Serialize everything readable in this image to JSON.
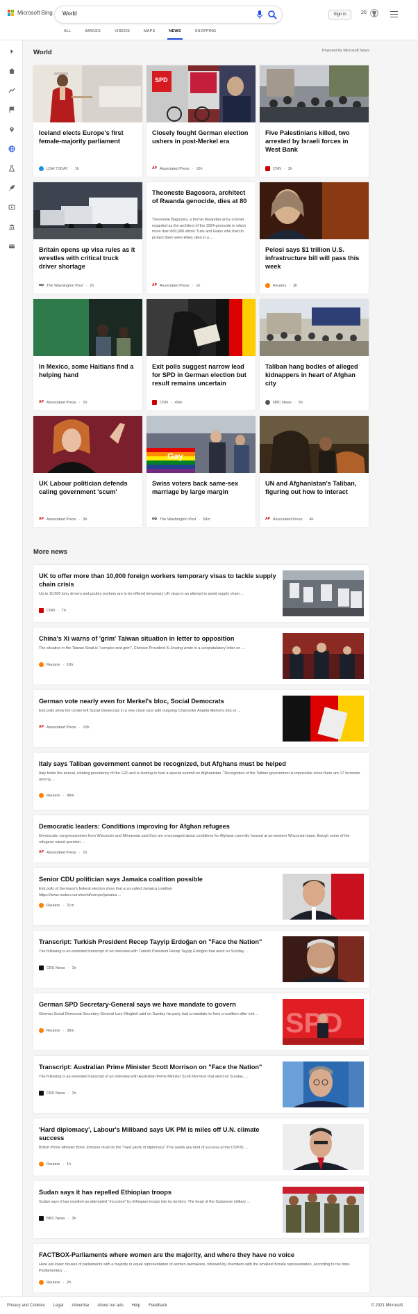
{
  "header": {
    "logo_text": "Microsoft Bing",
    "search_value": "World",
    "signin_label": "Sign in",
    "points": "20",
    "scopes": [
      "ALL",
      "IMAGES",
      "VIDEOS",
      "MAPS",
      "NEWS",
      "SHOPPING"
    ],
    "active_scope": "NEWS"
  },
  "world": {
    "title": "World",
    "powered_by": "Powered by Microsoft News",
    "cards": [
      {
        "title": "Iceland elects Europe's first female-majority parliament",
        "source": "USA TODAY",
        "time": "1h",
        "icon": "usa"
      },
      {
        "title": "Closely fought German election ushers in post-Merkel era",
        "source": "Associated Press",
        "time": "10h",
        "icon": "ap"
      },
      {
        "title": "Five Palestinians killed, two arrested by Israeli forces in West Bank",
        "source": "CNN",
        "time": "3h",
        "icon": "cnn"
      },
      {
        "title": "Britain opens up visa rules as it wrestles with critical truck driver shortage",
        "source": "The Washington Post",
        "time": "2h",
        "icon": "wapo"
      },
      {
        "title": "Theoneste Bagosora, architect of Rwanda genocide, dies at 80",
        "snippet": "Theoneste Bagosora, a former Rwandan army colonel regarded as the architect of the 1994 genocide in which more than 800,000 ethnic Tutsi and Hutus who tried to protect them were killed, died in a ...",
        "source": "Associated Press",
        "time": "1h",
        "icon": "ap"
      },
      {
        "title": "Pelosi says $1 trillion U.S. infrastructure bill will pass this week",
        "source": "Reuters",
        "time": "3h",
        "icon": "rt"
      },
      {
        "title": "In Mexico, some Haitians find a helping hand",
        "source": "Associated Press",
        "time": "1h",
        "icon": "ap"
      },
      {
        "title": "Exit polls suggest narrow lead for SPD in German election but result remains uncertain",
        "source": "CNN",
        "time": "49m",
        "icon": "cnn"
      },
      {
        "title": "Taliban hang bodies of alleged kidnappers in heart of Afghan city",
        "source": "NBC News",
        "time": "5h",
        "icon": "nbc"
      },
      {
        "title": "UK Labour politician defends caling government 'scum'",
        "source": "Associated Press",
        "time": "3h",
        "icon": "ap"
      },
      {
        "title": "Swiss voters back same-sex marriage by large margin",
        "source": "The Washington Post",
        "time": "59m",
        "icon": "wapo"
      },
      {
        "title": "UN and Afghanistan's Taliban, figuring out how to interact",
        "source": "Associated Press",
        "time": "4h",
        "icon": "ap"
      }
    ]
  },
  "more": {
    "title": "More news",
    "items": [
      {
        "title": "UK to offer more than 10,000 foreign workers temporary visas to tackle supply chain crisis",
        "snippet": "Up to 10,500 lorry drivers and poultry workers are to be offered temporary UK visas in an attempt to avoid supply chain ...",
        "source": "CNN",
        "time": "7h",
        "icon": "cnn"
      },
      {
        "title": "China's Xi warns of 'grim' Taiwan situation in letter to opposition",
        "snippet": "The situation in the Taiwan Strait is \"complex and grim\", Chinese President Xi Jinping wrote in a congratulatory letter on ...",
        "source": "Reuters",
        "time": "10h",
        "icon": "rt"
      },
      {
        "title": "German vote nearly even for Merkel's bloc, Social Democrats",
        "snippet": "Exit polls show the center-left Social Democrats in a very close race with outgoing Chancellor Angela Merkel's bloc in ...",
        "source": "Associated Press",
        "time": "10h",
        "icon": "ap"
      },
      {
        "title": "Italy says Taliban government cannot be recognized, but Afghans must be helped",
        "snippet": "Italy holds the annual, rotating presidency of the G20 and is looking to host a special summit on Afghanistan. \"Recognition of the Taliban government is impossible since there are 17 terrorists among ...",
        "source": "Reuters",
        "time": "49m",
        "icon": "rt"
      },
      {
        "title": "Democratic leaders: Conditions improving for Afghan refugees",
        "snippet": "Democratic congresswomen from Wisconsin and Minnesota said they are encouraged about conditions for Afghans currently housed at an western Wisconsin base, though some of the refugees raised question ...",
        "source": "Associated Press",
        "time": "1h",
        "icon": "ap"
      },
      {
        "title": "Senior CDU politician says Jamaica coalition possible",
        "snippet": "Exit polls of Germany's federal election show that a so-called Jamaica coalition https://www.reuters.com/world/europe/jamaica ...",
        "source": "Reuters",
        "time": "21m",
        "icon": "rt"
      },
      {
        "title": "Transcript: Turkish President Recep Tayyip Erdoğan on \"Face the Nation\"",
        "snippet": "The following is an extended transcript of an interview with Turkish President Recep Tayyip Erdoğan that aired on Sunday, ...",
        "source": "CBS News",
        "time": "1h",
        "icon": "cbs"
      },
      {
        "title": "German SPD Secretary-General says we have mandate to govern",
        "snippet": "German Social Democrat Secretary-General Lars Klingbeil said on Sunday his party had a mandate to form a coalition after exit ...",
        "source": "Reuters",
        "time": "38m",
        "icon": "rt"
      },
      {
        "title": "Transcript: Australian Prime Minister Scott Morrison on \"Face the Nation\"",
        "snippet": "The following is an extended transcript of an interview with Australian Prime Minister Scott Morrison that aired on Sunday, ...",
        "source": "CBS News",
        "time": "1h",
        "icon": "cbs"
      },
      {
        "title": "'Hard diplomacy', Labour's Miliband says UK PM is miles off U.N. climate success",
        "snippet": "British Prime Minister Boris Johnson must do the \"hard yards of diplomacy\" if he wants any kind of success at the COP26 ...",
        "source": "Reuters",
        "time": "1h",
        "icon": "rt"
      },
      {
        "title": "Sudan says it has repelled Ethiopian troops",
        "snippet": "Sudan says it has repelled an attempted \"incursion\" by Ethiopian troops into its territory. The head of the Sudanese military ...",
        "source": "BBC News",
        "time": "3h",
        "icon": "bbc"
      },
      {
        "title": "FACTBOX-Parliaments where women are the majority, and where they have no voice",
        "snippet": "Here are lower houses of parliaments with a majority or equal representation of women lawmakers, followed by chambers with the smallest female representation, according to the Inter-Parliamentary ...",
        "source": "Reuters",
        "time": "2h",
        "icon": "rt"
      }
    ]
  },
  "image_text": {
    "spd": "SPD",
    "gay": "Gay"
  },
  "footer": {
    "links": [
      "Privacy and Cookies",
      "Legal",
      "Advertise",
      "About our ads",
      "Help",
      "Feedback"
    ],
    "copyright": "© 2021 Microsoft"
  },
  "colors": {
    "accent": "#174ae4",
    "bing_red": "#f25022",
    "bing_green": "#7fba00",
    "bing_blue": "#00a4ef",
    "bing_yellow": "#ffb900"
  }
}
